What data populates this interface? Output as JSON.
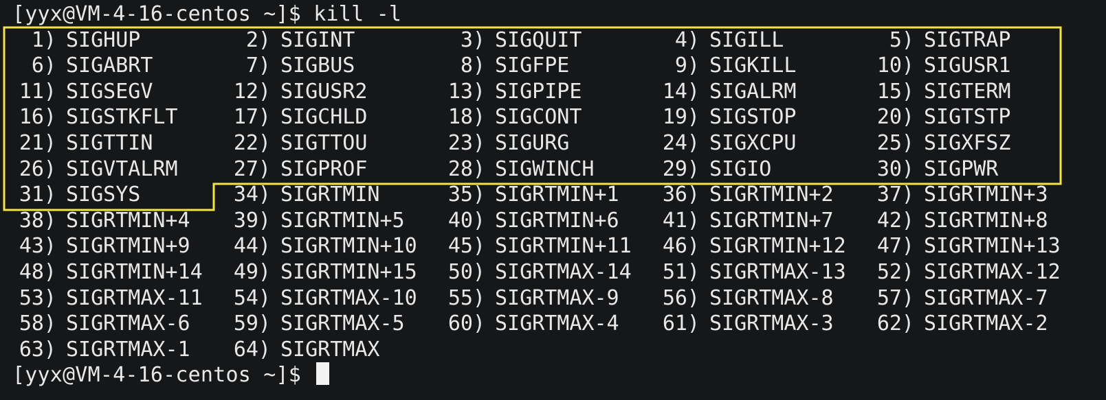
{
  "terminal": {
    "prompt": "[yyx@VM-4-16-centos ~]$ ",
    "command": "kill -l",
    "signals": [
      [
        {
          "num": " 1)",
          "name": "SIGHUP"
        },
        {
          "num": " 2)",
          "name": "SIGINT"
        },
        {
          "num": " 3)",
          "name": "SIGQUIT"
        },
        {
          "num": " 4)",
          "name": "SIGILL"
        },
        {
          "num": " 5)",
          "name": "SIGTRAP"
        }
      ],
      [
        {
          "num": " 6)",
          "name": "SIGABRT"
        },
        {
          "num": " 7)",
          "name": "SIGBUS"
        },
        {
          "num": " 8)",
          "name": "SIGFPE"
        },
        {
          "num": " 9)",
          "name": "SIGKILL"
        },
        {
          "num": "10)",
          "name": "SIGUSR1"
        }
      ],
      [
        {
          "num": "11)",
          "name": "SIGSEGV"
        },
        {
          "num": "12)",
          "name": "SIGUSR2"
        },
        {
          "num": "13)",
          "name": "SIGPIPE"
        },
        {
          "num": "14)",
          "name": "SIGALRM"
        },
        {
          "num": "15)",
          "name": "SIGTERM"
        }
      ],
      [
        {
          "num": "16)",
          "name": "SIGSTKFLT"
        },
        {
          "num": "17)",
          "name": "SIGCHLD"
        },
        {
          "num": "18)",
          "name": "SIGCONT"
        },
        {
          "num": "19)",
          "name": "SIGSTOP"
        },
        {
          "num": "20)",
          "name": "SIGTSTP"
        }
      ],
      [
        {
          "num": "21)",
          "name": "SIGTTIN"
        },
        {
          "num": "22)",
          "name": "SIGTTOU"
        },
        {
          "num": "23)",
          "name": "SIGURG"
        },
        {
          "num": "24)",
          "name": "SIGXCPU"
        },
        {
          "num": "25)",
          "name": "SIGXFSZ"
        }
      ],
      [
        {
          "num": "26)",
          "name": "SIGVTALRM"
        },
        {
          "num": "27)",
          "name": "SIGPROF"
        },
        {
          "num": "28)",
          "name": "SIGWINCH"
        },
        {
          "num": "29)",
          "name": "SIGIO"
        },
        {
          "num": "30)",
          "name": "SIGPWR"
        }
      ],
      [
        {
          "num": "31)",
          "name": "SIGSYS"
        },
        {
          "num": "34)",
          "name": "SIGRTMIN"
        },
        {
          "num": "35)",
          "name": "SIGRTMIN+1"
        },
        {
          "num": "36)",
          "name": "SIGRTMIN+2"
        },
        {
          "num": "37)",
          "name": "SIGRTMIN+3"
        }
      ],
      [
        {
          "num": "38)",
          "name": "SIGRTMIN+4"
        },
        {
          "num": "39)",
          "name": "SIGRTMIN+5"
        },
        {
          "num": "40)",
          "name": "SIGRTMIN+6"
        },
        {
          "num": "41)",
          "name": "SIGRTMIN+7"
        },
        {
          "num": "42)",
          "name": "SIGRTMIN+8"
        }
      ],
      [
        {
          "num": "43)",
          "name": "SIGRTMIN+9"
        },
        {
          "num": "44)",
          "name": "SIGRTMIN+10"
        },
        {
          "num": "45)",
          "name": "SIGRTMIN+11"
        },
        {
          "num": "46)",
          "name": "SIGRTMIN+12"
        },
        {
          "num": "47)",
          "name": "SIGRTMIN+13"
        }
      ],
      [
        {
          "num": "48)",
          "name": "SIGRTMIN+14"
        },
        {
          "num": "49)",
          "name": "SIGRTMIN+15"
        },
        {
          "num": "50)",
          "name": "SIGRTMAX-14"
        },
        {
          "num": "51)",
          "name": "SIGRTMAX-13"
        },
        {
          "num": "52)",
          "name": "SIGRTMAX-12"
        }
      ],
      [
        {
          "num": "53)",
          "name": "SIGRTMAX-11"
        },
        {
          "num": "54)",
          "name": "SIGRTMAX-10"
        },
        {
          "num": "55)",
          "name": "SIGRTMAX-9"
        },
        {
          "num": "56)",
          "name": "SIGRTMAX-8"
        },
        {
          "num": "57)",
          "name": "SIGRTMAX-7"
        }
      ],
      [
        {
          "num": "58)",
          "name": "SIGRTMAX-6"
        },
        {
          "num": "59)",
          "name": "SIGRTMAX-5"
        },
        {
          "num": "60)",
          "name": "SIGRTMAX-4"
        },
        {
          "num": "61)",
          "name": "SIGRTMAX-3"
        },
        {
          "num": "62)",
          "name": "SIGRTMAX-2"
        }
      ],
      [
        {
          "num": "63)",
          "name": "SIGRTMAX-1"
        },
        {
          "num": "64)",
          "name": "SIGRTMAX"
        }
      ]
    ]
  },
  "colors": {
    "background": "#161719",
    "text": "#e8e8e8",
    "highlight": "#f2e34b"
  }
}
